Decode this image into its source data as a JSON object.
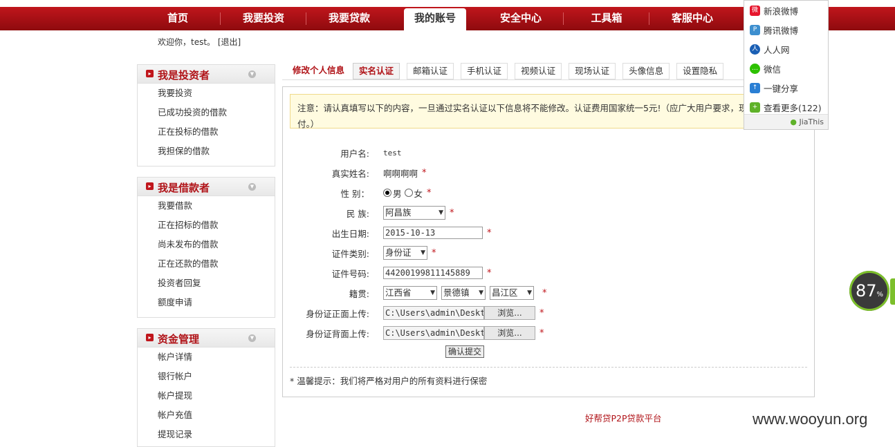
{
  "nav": {
    "items": [
      "首页",
      "我要投资",
      "我要贷款",
      "我的账号",
      "安全中心",
      "工具箱",
      "客服中心"
    ],
    "active_index": 3
  },
  "welcome": {
    "text": "欢迎你，test。",
    "logout": "[退出]"
  },
  "sidebar": {
    "investor": {
      "title": "我是投资者",
      "items": [
        "我要投资",
        "已成功投资的借款",
        "正在投标的借款",
        "我担保的借款"
      ]
    },
    "borrower": {
      "title": "我是借款者",
      "items": [
        "我要借款",
        "正在招标的借款",
        "尚未发布的借款",
        "正在还款的借款",
        "投资者回复",
        "额度申请"
      ]
    },
    "funds": {
      "title": "资金管理",
      "items": [
        "帐户详情",
        "银行帐户",
        "帐户提现",
        "帐户充值",
        "提现记录"
      ]
    }
  },
  "tabs": [
    "修改个人信息",
    "实名认证",
    "邮箱认证",
    "手机认证",
    "视频认证",
    "现场认证",
    "头像信息",
    "设置隐私"
  ],
  "active_tab": 1,
  "notice": {
    "line1": "注意：请认真填写以下的内容，一旦通过实名认证以下信息将不能修改。认证费用国家统一5元!（应广大用户要求，现认证",
    "line2": "付。）"
  },
  "form": {
    "username_label": "用户名:",
    "username_value": "test",
    "realname_label": "真实姓名:",
    "realname_value": "啊啊啊啊",
    "gender_label": "性 别：",
    "gender_male": "男",
    "gender_female": "女",
    "gender_selected": "男",
    "nation_label": "民 族:",
    "nation_value": "阿昌族",
    "birth_label": "出生日期:",
    "birth_value": "2015-10-13",
    "idtype_label": "证件类别:",
    "idtype_value": "身份证",
    "idno_label": "证件号码:",
    "idno_value": "44200199811145889",
    "native_label": "籍贯:",
    "province": "江西省",
    "city": "景德镇",
    "district": "昌江区",
    "front_label": "身份证正面上传:",
    "front_path": "C:\\Users\\admin\\Desktop",
    "back_label": "身份证背面上传:",
    "back_path": "C:\\Users\\admin\\Desktop",
    "browse": "浏览...",
    "required": "*",
    "submit": "确认提交"
  },
  "tip": "* 温馨提示：我们将严格对用户的所有资料进行保密",
  "footer": "好帮贷P2P贷款平台",
  "watermark": "www.wooyun.org",
  "share": {
    "items": [
      {
        "label": "新浪微博",
        "icon": "weibo-icon",
        "color": "#e6162d"
      },
      {
        "label": "腾讯微博",
        "icon": "tencent-weibo-icon",
        "color": "#3d8fcf"
      },
      {
        "label": "人人网",
        "icon": "renren-icon",
        "color": "#1a5fb4"
      },
      {
        "label": "微信",
        "icon": "wechat-icon",
        "color": "#2dc100"
      },
      {
        "label": "一键分享",
        "icon": "share-icon",
        "color": "#2a7fd4"
      },
      {
        "label": "查看更多(122)",
        "icon": "more-icon",
        "color": "#5fb22a"
      }
    ],
    "brand": "JiaThis"
  },
  "gauge": {
    "value": "87",
    "unit": "%"
  },
  "colors": {
    "brand_red": "#b01217",
    "accent_green": "#7cbf2b"
  }
}
